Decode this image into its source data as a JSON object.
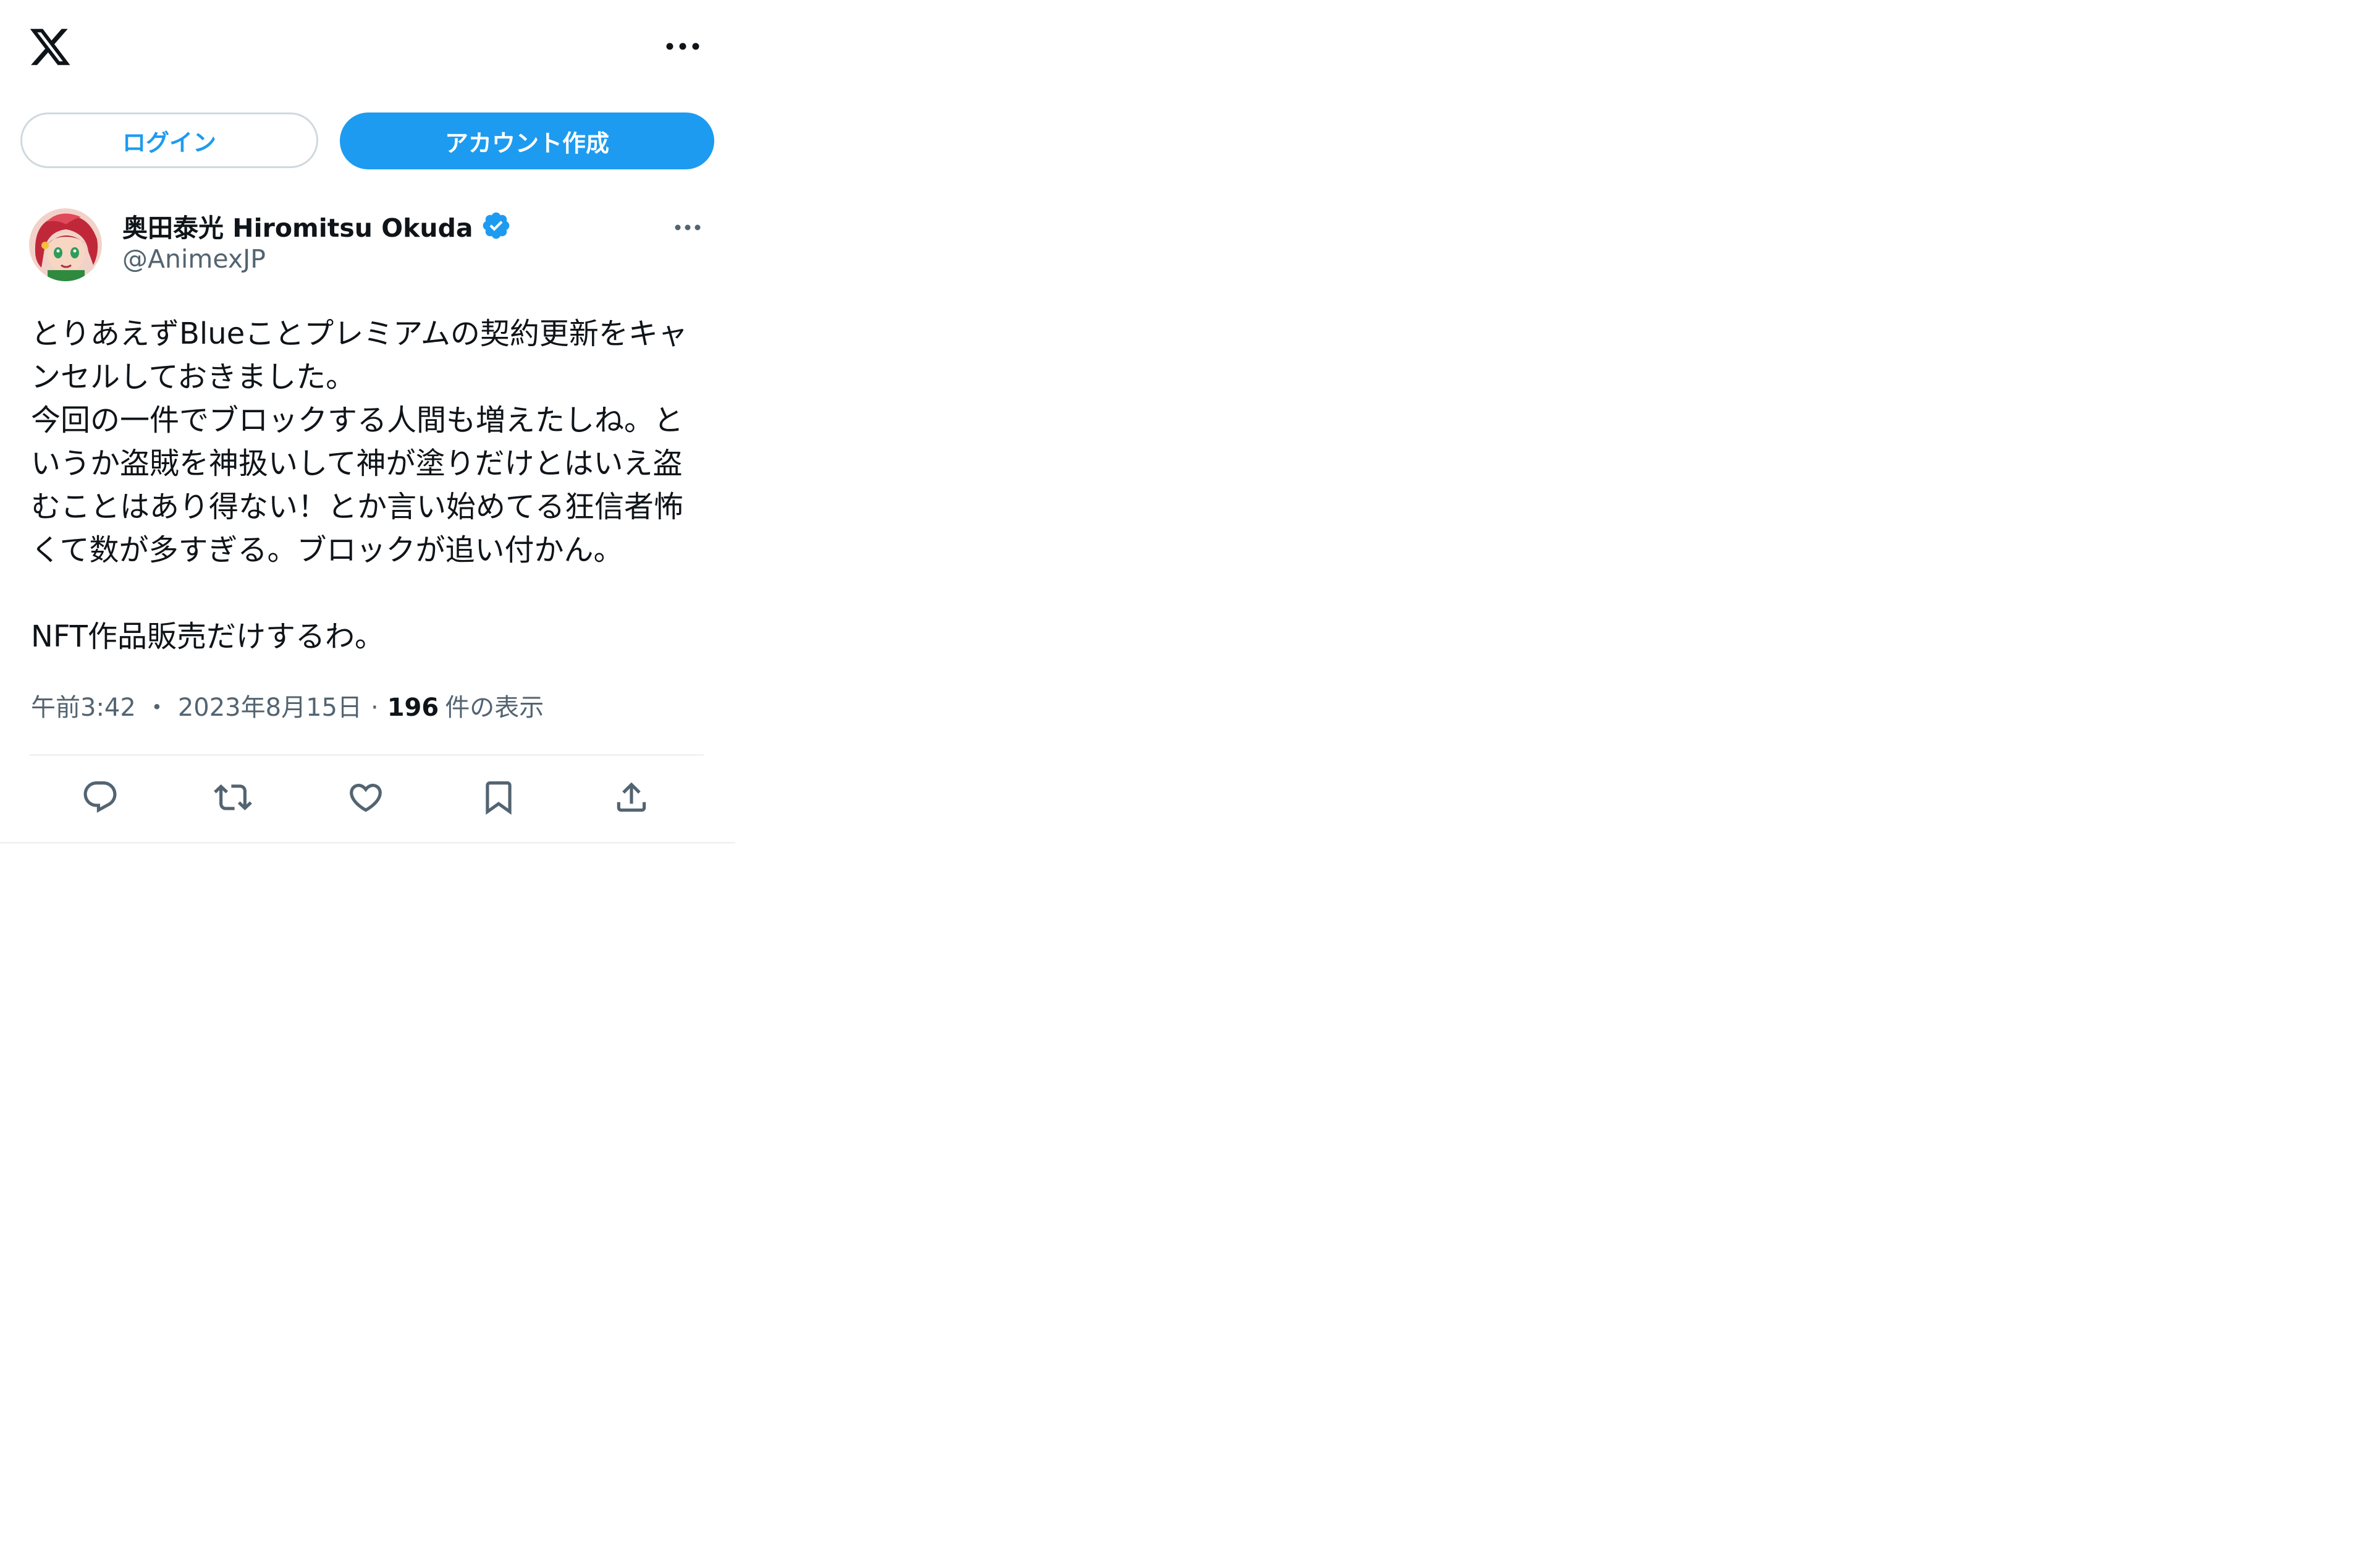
{
  "brand": {
    "logo_icon": "x-logo-icon"
  },
  "auth": {
    "login_label": "ログイン",
    "signup_label": "アカウント作成"
  },
  "tweet": {
    "display_name": "奥田泰光 Hiromitsu Okuda",
    "handle": "@AnimexJP",
    "verified": true,
    "text": "とりあえずBlueことプレミアムの契約更新をキャンセルしておきました。\n今回の一件でブロックする人間も増えたしね。というか盗賊を神扱いして神が塗りだけとはいえ盗むことはあり得ない！とか言い始めてる狂信者怖くて数が多すぎる。ブロックが追い付かん。\n\nNFT作品販売だけするわ。",
    "time": "午前3:42",
    "date": "2023年8月15日",
    "separator": "・",
    "separator2": "·",
    "views_count": "196",
    "views_label": "件の表示"
  },
  "actions": [
    {
      "icon": "reply-icon"
    },
    {
      "icon": "retweet-icon"
    },
    {
      "icon": "like-icon"
    },
    {
      "icon": "bookmark-icon"
    },
    {
      "icon": "share-icon"
    }
  ],
  "colors": {
    "accent": "#1d9bf0",
    "text_primary": "#0f1419",
    "text_secondary": "#536471",
    "border": "#cfd9de",
    "divider": "#eff3f4"
  }
}
